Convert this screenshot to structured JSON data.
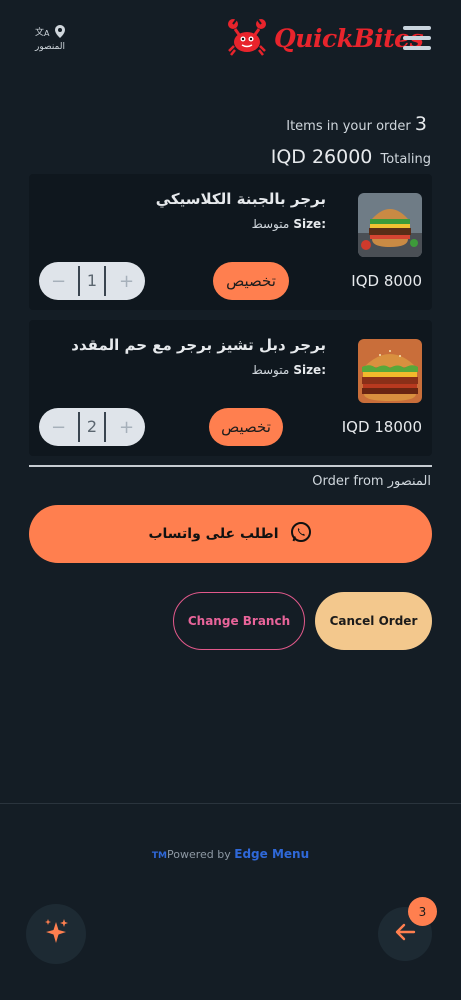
{
  "header": {
    "branch_label": "المنصور",
    "brand": "QuickBites",
    "icons": [
      "location-pin-icon",
      "translate-icon",
      "crab-logo-icon",
      "menu-icon"
    ],
    "brand_color": "#e8242c"
  },
  "summary": {
    "item_count": "3",
    "items_label": "Items in your order",
    "total": "IQD 26000",
    "totaling_label": "Totaling"
  },
  "items": [
    {
      "name": "برجر بالجبنة الكلاسيكي",
      "size_label": "Size:",
      "size_value": "متوسط",
      "price": "IQD 8000",
      "customize_label": "تخصيص",
      "quantity": "1",
      "minus": "−",
      "plus": "+"
    },
    {
      "name": "برجر دبل تشيز برجر مع حم المقدد",
      "size_label": "Size:",
      "size_value": "متوسط",
      "price": "IQD 18000",
      "customize_label": "تخصيص",
      "quantity": "2",
      "minus": "−",
      "plus": "+"
    }
  ],
  "order_from": "Order from المنصور",
  "actions": {
    "whatsapp_label": "اطلب على واتساب",
    "change_branch": "Change Branch",
    "cancel_order": "Cancel Order"
  },
  "footer": {
    "tm": "TM",
    "powered_by": "Powered by",
    "brand": "Edge Menu"
  },
  "fab": {
    "badge": "3",
    "left_icon": "sparkles-icon",
    "right_icon": "arrow-left-icon"
  },
  "colors": {
    "accent": "#ff7f4f",
    "background": "#141d25",
    "card": "#0f171e",
    "cancel": "#f3c88d",
    "change_branch": "#e2598b",
    "powered_brand": "#2f68d8"
  }
}
